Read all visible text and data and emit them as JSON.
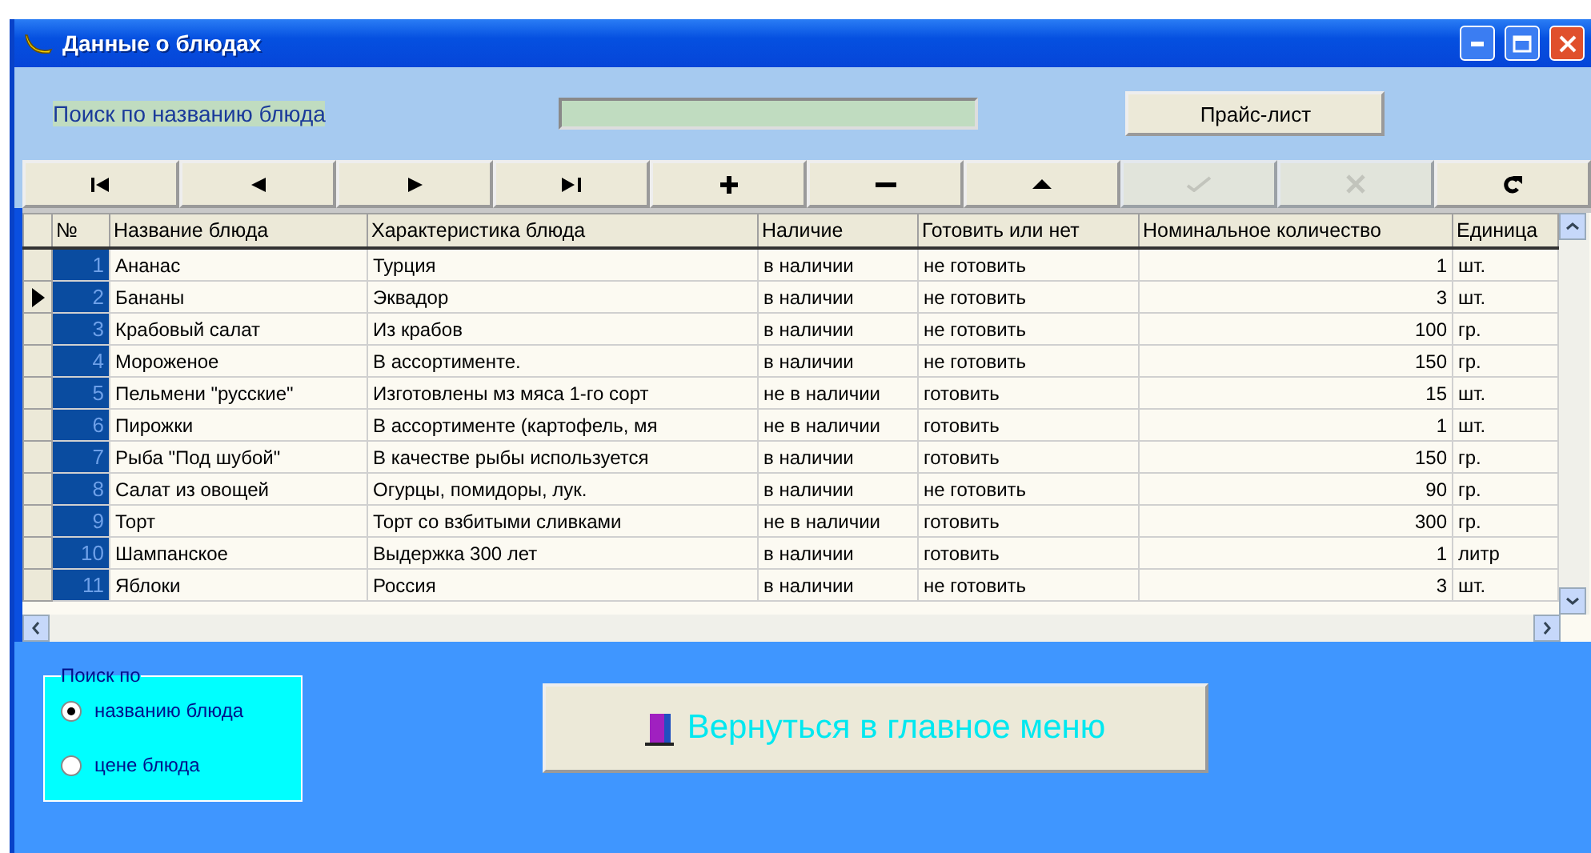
{
  "window": {
    "title": "Данные о блюдах"
  },
  "search": {
    "label": "Поиск по названию блюда",
    "price_button": "Прайс-лист"
  },
  "navigator": [
    {
      "kind": "first",
      "disabled": false
    },
    {
      "kind": "prior",
      "disabled": false
    },
    {
      "kind": "next",
      "disabled": false
    },
    {
      "kind": "last",
      "disabled": false
    },
    {
      "kind": "insert",
      "disabled": false
    },
    {
      "kind": "delete",
      "disabled": false
    },
    {
      "kind": "edit",
      "disabled": false
    },
    {
      "kind": "post",
      "disabled": true
    },
    {
      "kind": "cancel",
      "disabled": true
    },
    {
      "kind": "refresh",
      "disabled": false
    }
  ],
  "table": {
    "columns": [
      "№",
      "Название блюда",
      "Характеристика блюда",
      "Наличие",
      "Готовить или нет",
      "Номинальное количество",
      "Единица"
    ],
    "rows": [
      {
        "selected": false,
        "cells": [
          "1",
          "Ананас",
          "Турция",
          "в наличии",
          "не готовить",
          "1",
          "шт."
        ]
      },
      {
        "selected": true,
        "cells": [
          "2",
          "Бананы",
          "Эквадор",
          "в наличии",
          "не готовить",
          "3",
          "шт."
        ]
      },
      {
        "selected": false,
        "cells": [
          "3",
          "Крабовый салат",
          "Из крабов",
          "в наличии",
          "не готовить",
          "100",
          "гр."
        ]
      },
      {
        "selected": false,
        "cells": [
          "4",
          "Мороженое",
          "В ассортименте.",
          "в наличии",
          "не готовить",
          "150",
          "гр."
        ]
      },
      {
        "selected": false,
        "cells": [
          "5",
          "Пельмени \"русские\"",
          "Изготовлены мз мяса 1-го сорт",
          "не в наличии",
          "готовить",
          "15",
          "шт."
        ]
      },
      {
        "selected": false,
        "cells": [
          "6",
          "Пирожки",
          "В ассортименте (картофель, мя",
          "не в наличии",
          "готовить",
          "1",
          "шт."
        ]
      },
      {
        "selected": false,
        "cells": [
          "7",
          "Рыба \"Под шубой\"",
          "В качестве рыбы используется",
          "в наличии",
          "готовить",
          "150",
          "гр."
        ]
      },
      {
        "selected": false,
        "cells": [
          "8",
          "Салат из овощей",
          "Огурцы, помидоры, лук.",
          "в наличии",
          "не готовить",
          "90",
          "гр."
        ]
      },
      {
        "selected": false,
        "cells": [
          "9",
          "Торт",
          "Торт со взбитыми сливками",
          "не в наличии",
          "готовить",
          "300",
          "гр."
        ]
      },
      {
        "selected": false,
        "cells": [
          "10",
          "Шампанское",
          "Выдержка 300 лет",
          "в наличии",
          "готовить",
          "1",
          "литр"
        ]
      },
      {
        "selected": false,
        "cells": [
          "11",
          "Яблоки",
          "Россия",
          "в наличии",
          "не готовить",
          "3",
          "шт."
        ]
      }
    ]
  },
  "search_by": {
    "title": "Поиск по",
    "options": [
      {
        "label": "названию блюда",
        "selected": true
      },
      {
        "label": "цене блюда",
        "selected": false
      }
    ]
  },
  "back_button": "Вернуться в главное меню"
}
